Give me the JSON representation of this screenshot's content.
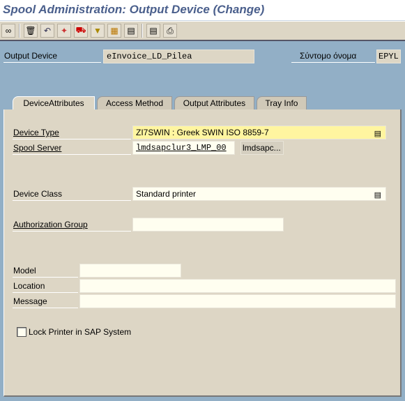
{
  "title": "Spool Administration: Output Device (Change)",
  "toolbar": {
    "icons": [
      "display-change-icon",
      "delete-icon",
      "undo-icon",
      "new-entry-icon",
      "transport-icon",
      "filter-icon",
      "hierarchy-icon",
      "save-layout-icon",
      "list-icon",
      "print-icon"
    ]
  },
  "header": {
    "output_device_label": "Output Device",
    "output_device_value": "eInvoice_LD_Pilea",
    "short_name_label": "Σύντομο όνομα",
    "short_name_value": "EPYL"
  },
  "tabs": [
    {
      "label": "DeviceAttributes"
    },
    {
      "label": "Access Method"
    },
    {
      "label": "Output Attributes"
    },
    {
      "label": "Tray Info"
    }
  ],
  "form": {
    "device_type_label": "Device Type",
    "device_type_value": "ZI7SWIN  : Greek SWIN ISO 8859-7",
    "spool_server_label": "Spool Server",
    "spool_server_value": "lmdsapclur3_LMP_00",
    "spool_server_button": "lmdsapc...",
    "device_class_label": "Device Class",
    "device_class_value": "Standard printer",
    "auth_group_label": "Authorization Group",
    "auth_group_value": "",
    "model_label": "Model",
    "model_value": "",
    "location_label": "Location",
    "location_value": "",
    "message_label": "Message",
    "message_value": "",
    "lock_label": "Lock Printer in SAP System",
    "lock_checked": false
  },
  "colors": {
    "highlight_field": "#fff5a0",
    "background": "#92afc6",
    "panel": "#ddd6c5",
    "title": "#4a5f8c"
  }
}
